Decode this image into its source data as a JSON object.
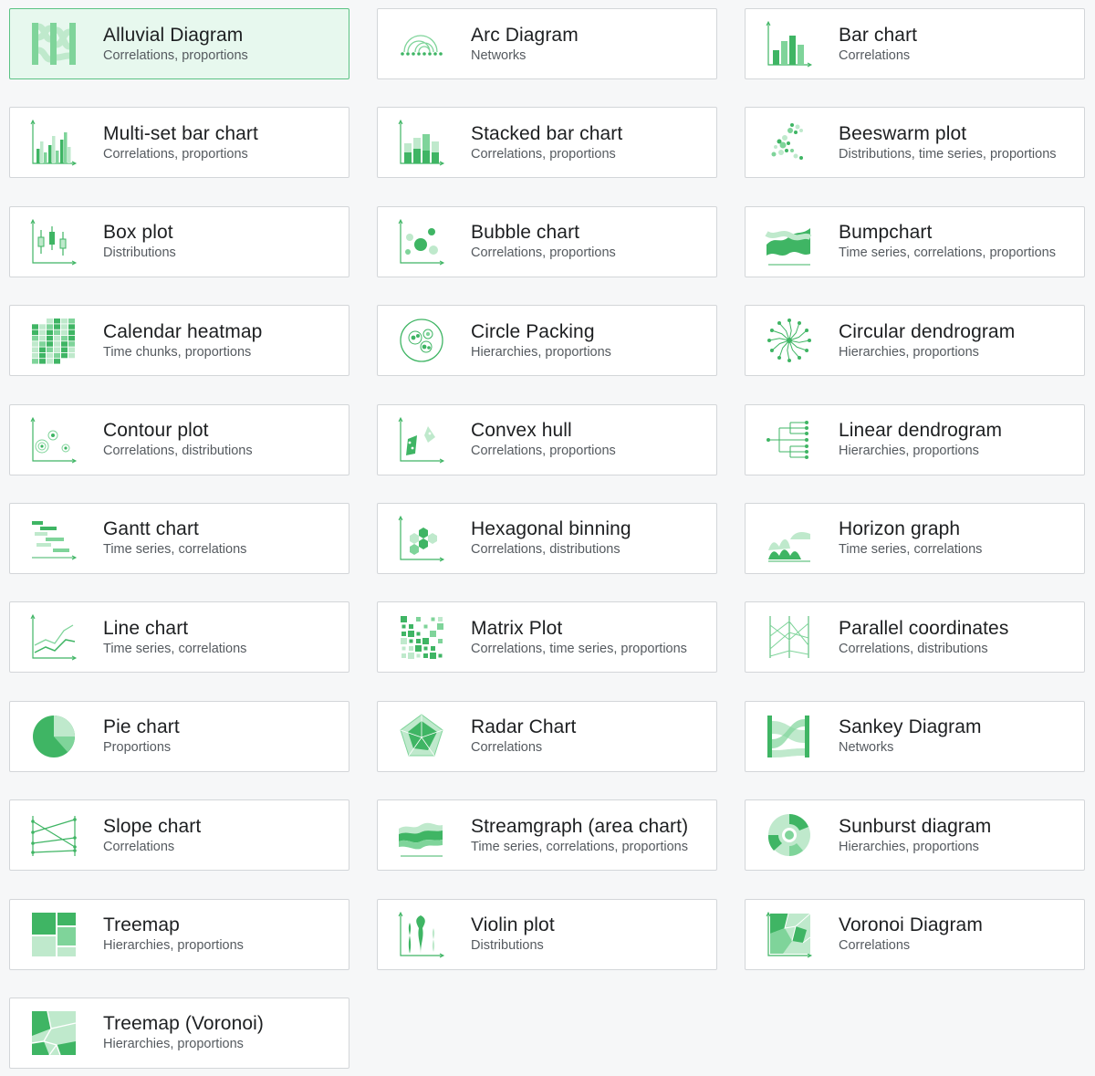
{
  "colors": {
    "accent": "#3fb564",
    "accent_mid": "#7fd49a",
    "accent_light": "#bfe9cc",
    "selected_bg": "#e7f8ee",
    "selected_border": "#5cc384"
  },
  "items": [
    {
      "title": "Alluvial Diagram",
      "subtitle": "Correlations, proportions",
      "icon": "alluvial-icon",
      "selected": true
    },
    {
      "title": "Arc Diagram",
      "subtitle": "Networks",
      "icon": "arc-icon"
    },
    {
      "title": "Bar chart",
      "subtitle": "Correlations",
      "icon": "bar-icon"
    },
    {
      "title": "Multi-set bar chart",
      "subtitle": "Correlations, proportions",
      "icon": "multiset-bar-icon"
    },
    {
      "title": "Stacked bar chart",
      "subtitle": "Correlations, proportions",
      "icon": "stacked-bar-icon"
    },
    {
      "title": "Beeswarm plot",
      "subtitle": "Distributions, time series, proportions",
      "icon": "beeswarm-icon"
    },
    {
      "title": "Box plot",
      "subtitle": "Distributions",
      "icon": "boxplot-icon"
    },
    {
      "title": "Bubble chart",
      "subtitle": "Correlations, proportions",
      "icon": "bubble-icon"
    },
    {
      "title": "Bumpchart",
      "subtitle": "Time series, correlations, proportions",
      "icon": "bumpchart-icon"
    },
    {
      "title": "Calendar heatmap",
      "subtitle": "Time chunks, proportions",
      "icon": "calendar-heatmap-icon"
    },
    {
      "title": "Circle Packing",
      "subtitle": "Hierarchies, proportions",
      "icon": "circle-packing-icon"
    },
    {
      "title": "Circular dendrogram",
      "subtitle": "Hierarchies, proportions",
      "icon": "circular-dendrogram-icon"
    },
    {
      "title": "Contour plot",
      "subtitle": "Correlations, distributions",
      "icon": "contour-icon"
    },
    {
      "title": "Convex hull",
      "subtitle": "Correlations, proportions",
      "icon": "convex-hull-icon"
    },
    {
      "title": "Linear dendrogram",
      "subtitle": "Hierarchies, proportions",
      "icon": "linear-dendrogram-icon"
    },
    {
      "title": "Gantt chart",
      "subtitle": "Time series, correlations",
      "icon": "gantt-icon"
    },
    {
      "title": "Hexagonal binning",
      "subtitle": "Correlations, distributions",
      "icon": "hexbin-icon"
    },
    {
      "title": "Horizon graph",
      "subtitle": "Time series, correlations",
      "icon": "horizon-icon"
    },
    {
      "title": "Line chart",
      "subtitle": "Time series, correlations",
      "icon": "line-chart-icon"
    },
    {
      "title": "Matrix Plot",
      "subtitle": "Correlations, time series, proportions",
      "icon": "matrix-icon"
    },
    {
      "title": "Parallel coordinates",
      "subtitle": "Correlations, distributions",
      "icon": "parallel-coordinates-icon"
    },
    {
      "title": "Pie chart",
      "subtitle": "Proportions",
      "icon": "pie-icon"
    },
    {
      "title": "Radar Chart",
      "subtitle": "Correlations",
      "icon": "radar-icon"
    },
    {
      "title": "Sankey Diagram",
      "subtitle": "Networks",
      "icon": "sankey-icon"
    },
    {
      "title": "Slope chart",
      "subtitle": "Correlations",
      "icon": "slope-icon"
    },
    {
      "title": "Streamgraph (area chart)",
      "subtitle": "Time series, correlations, proportions",
      "icon": "streamgraph-icon"
    },
    {
      "title": "Sunburst diagram",
      "subtitle": "Hierarchies, proportions",
      "icon": "sunburst-icon"
    },
    {
      "title": "Treemap",
      "subtitle": "Hierarchies, proportions",
      "icon": "treemap-icon"
    },
    {
      "title": "Violin plot",
      "subtitle": "Distributions",
      "icon": "violin-icon"
    },
    {
      "title": "Voronoi Diagram",
      "subtitle": "Correlations",
      "icon": "voronoi-icon"
    },
    {
      "title": "Treemap (Voronoi)",
      "subtitle": "Hierarchies, proportions",
      "icon": "voronoi-treemap-icon"
    }
  ]
}
